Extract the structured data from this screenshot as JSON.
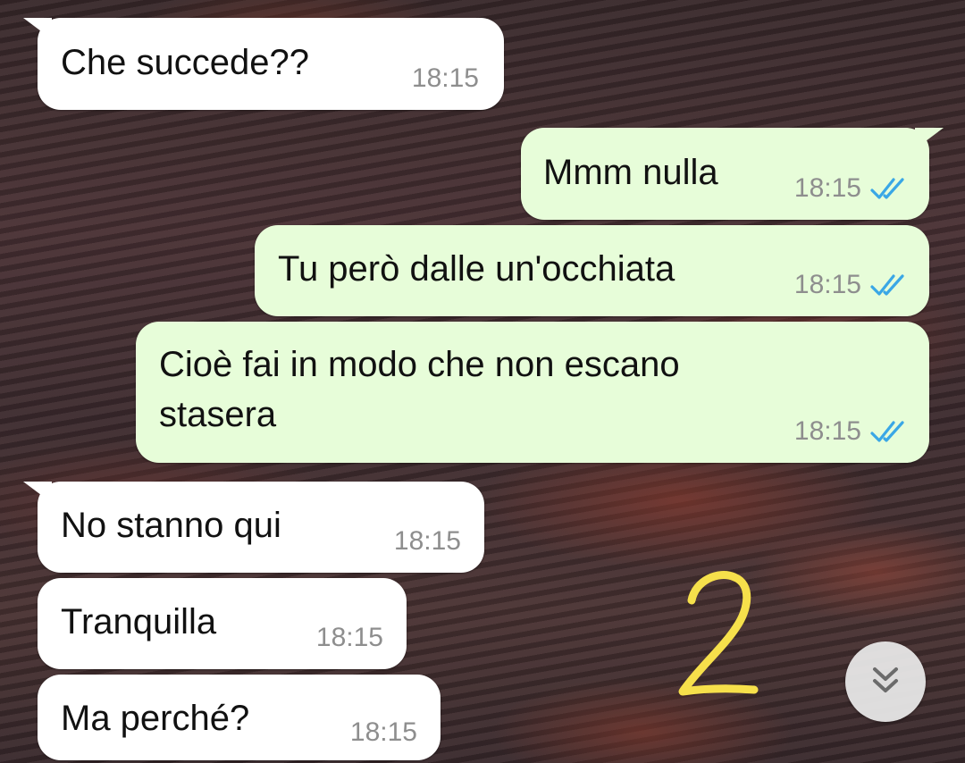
{
  "messages": [
    {
      "direction": "in",
      "text": "Che succede??",
      "time": "18:15"
    },
    {
      "direction": "out",
      "text": "Mmm nulla",
      "time": "18:15",
      "status_icon": "double-check-read-icon"
    },
    {
      "direction": "out",
      "text": "Tu però dalle un'occhiata",
      "time": "18:15",
      "status_icon": "double-check-read-icon"
    },
    {
      "direction": "out",
      "text_line1": "Cioè fai in modo che non escano",
      "text_line2": "stasera",
      "time": "18:15",
      "status_icon": "double-check-read-icon"
    },
    {
      "direction": "in",
      "text": "No stanno qui",
      "time": "18:15"
    },
    {
      "direction": "in",
      "text": "Tranquilla",
      "time": "18:15"
    },
    {
      "direction": "in",
      "text": "Ma perché?",
      "time": "18:15"
    }
  ],
  "annotation": {
    "label": "2",
    "color": "#f6e04b"
  },
  "scroll_button": {
    "icon": "double-chevron-down-icon"
  },
  "colors": {
    "incoming_bubble": "#ffffff",
    "outgoing_bubble": "#e7fdd9",
    "timestamp": "#8e8e8e",
    "read_ticks": "#3aa7e6"
  }
}
